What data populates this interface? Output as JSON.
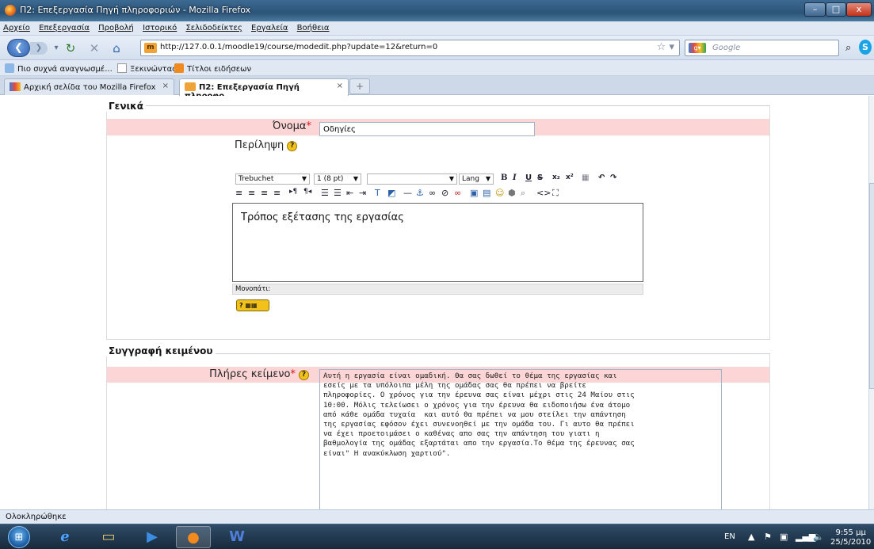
{
  "window": {
    "title": "Π2: Επεξεργασία Πηγή πληροφοριών - Mozilla Firefox",
    "minimize": "–",
    "maximize": "□",
    "close": "x"
  },
  "menu": [
    "Αρχείο",
    "Επεξεργασία",
    "Προβολή",
    "Ιστορικό",
    "Σελιδοδείκτες",
    "Εργαλεία",
    "Βοήθεια"
  ],
  "nav": {
    "url": "http://127.0.0.1/moodle19/course/modedit.php?update=12&return=0",
    "search_placeholder": "Google"
  },
  "bookmarks": [
    "Πιο συχνά αναγνωσμέ...",
    "Ξεκινώντας",
    "Τίτλοι ειδήσεων"
  ],
  "tabs": [
    {
      "label": "Αρχική σελίδα του Mozilla Firefox"
    },
    {
      "label": "Π2: Επεξεργασία Πηγή πληροφο..."
    }
  ],
  "general": {
    "legend": "Γενικά",
    "name_label": "Όνομα",
    "name_value": "Οδηγίες",
    "summary_label": "Περίληψη"
  },
  "editor": {
    "font": "Trebuchet",
    "size": "1 (8 pt)",
    "lang": "Lang",
    "content": "Τρόπος εξέτασης της εργασίας",
    "path_label": "Μονοπάτι:"
  },
  "writing": {
    "legend": "Συγγραφή κειμένου",
    "fulltext_label": "Πλήρες κείμενο",
    "fulltext": "Αυτή η εργασία είναι ομαδική. Θα σας δωθεί το θέμα της εργασίας και\nεσείς με τα υπόλοιπα μέλη της ομάδας σας θα πρέπει να βρείτε\nπληροφορίες. Ο χρόνος για την έρευνα σας είναι μέχρι στις 24 Μαίου στις\n10:00. Μόλις τελείωσει ο χρόνος για την έρευνα θα ειδοποιήσω ένα άτομο\nαπό κάθε ομάδα τυχαία  και αυτό θα πρέπει να μου στείλει την απάντηση\nτης εργασίας εφόσον έχει συνενοηθεί με την ομάδα του. Γι αυτο θα πρέπει\nνα έχει προετοιμάσει ο καθένας απο σας την απάντηση του γιατι η\nβαθμολογία της ομάδας εξαρτάται απο την εργασία.Το θέμα της έρευνας σας\nείναι\" Η ανακύκλωση χαρτιού\"."
  },
  "status": "Ολοκληρώθηκε",
  "taskbar": {
    "lang": "EN",
    "time": "9:55 μμ",
    "date": "25/5/2010"
  }
}
